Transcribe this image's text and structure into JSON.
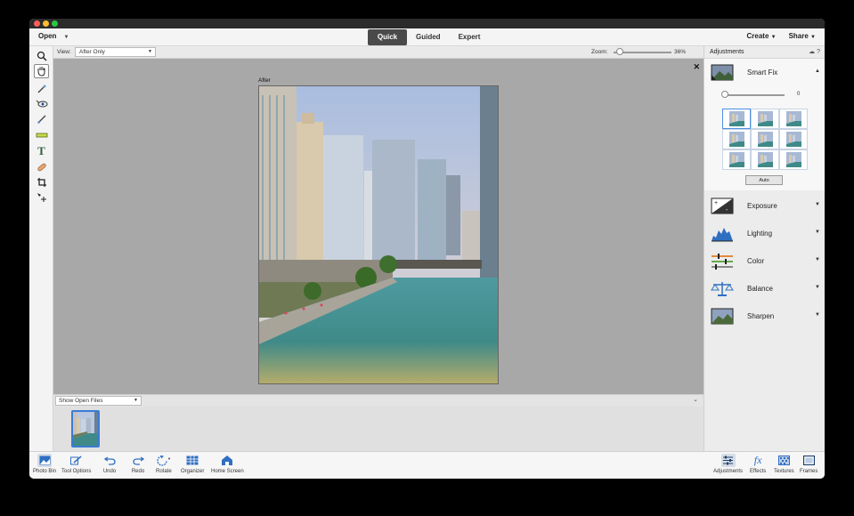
{
  "menubar": {
    "open_label": "Open",
    "modes": [
      "Quick",
      "Guided",
      "Expert"
    ],
    "create_label": "Create",
    "share_label": "Share"
  },
  "viewbar": {
    "view_label": "View:",
    "view_value": "After Only",
    "zoom_label": "Zoom:",
    "zoom_value": "36%"
  },
  "canvas": {
    "after_label": "After"
  },
  "bin": {
    "show_label": "Show Open Files"
  },
  "panel": {
    "title": "Adjustments",
    "smart_fix": "Smart Fix",
    "smart_fix_value": "0",
    "auto_label": "Auto",
    "items": [
      "Exposure",
      "Lighting",
      "Color",
      "Balance",
      "Sharpen"
    ]
  },
  "bottom": {
    "left": [
      "Photo Bin",
      "Tool Options",
      "Undo",
      "Redo",
      "Rotate",
      "Organizer",
      "Home Screen"
    ],
    "right": [
      "Adjustments",
      "Effects",
      "Textures",
      "Frames"
    ]
  },
  "colors": {
    "accent": "#3a7bd5",
    "water": "#3f8c8a",
    "sky": "#b9c8e0"
  }
}
